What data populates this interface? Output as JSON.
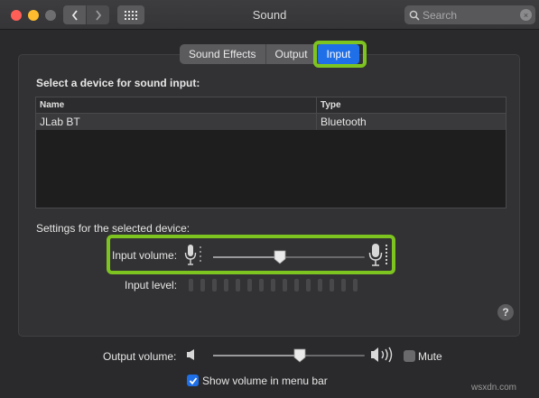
{
  "window": {
    "title": "Sound"
  },
  "search": {
    "placeholder": "Search"
  },
  "tabs": [
    {
      "label": "Sound Effects",
      "active": false
    },
    {
      "label": "Output",
      "active": false
    },
    {
      "label": "Input",
      "active": true
    }
  ],
  "device_section": {
    "title": "Select a device for sound input:",
    "columns": [
      "Name",
      "Type"
    ],
    "rows": [
      {
        "name": "JLab BT",
        "type": "Bluetooth"
      }
    ]
  },
  "settings": {
    "title": "Settings for the selected device:",
    "input_volume_label": "Input volume:",
    "input_volume_percent": 44,
    "input_level_label": "Input level:",
    "input_level_segments": 15
  },
  "output": {
    "label": "Output volume:",
    "volume_percent": 57,
    "mute_label": "Mute",
    "mute_checked": false,
    "show_in_menu_bar_label": "Show volume in menu bar",
    "show_in_menu_bar_checked": true
  },
  "help": {
    "label": "?"
  },
  "watermark": "wsxdn.com",
  "colors": {
    "accent": "#1f6fe8",
    "highlight": "#7ec421"
  }
}
